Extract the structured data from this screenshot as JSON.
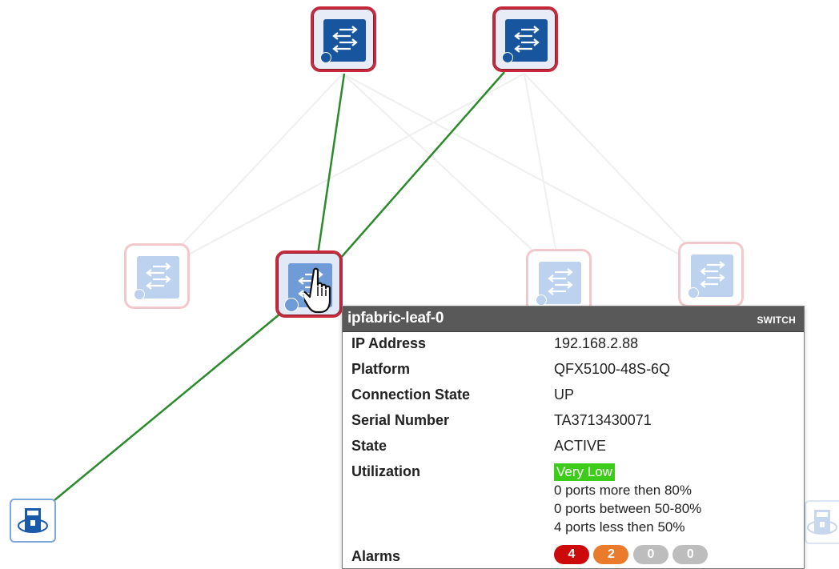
{
  "tooltip": {
    "title": "ipfabric-leaf-0",
    "type": "SWITCH",
    "rows": [
      {
        "label": "IP Address",
        "value": "192.168.2.88"
      },
      {
        "label": "Platform",
        "value": "QFX5100-48S-6Q"
      },
      {
        "label": "Connection State",
        "value": "UP"
      },
      {
        "label": "Serial Number",
        "value": "TA3713430071"
      },
      {
        "label": "State",
        "value": "ACTIVE"
      }
    ],
    "utilization": {
      "label": "Utilization",
      "level": "Very Low",
      "level_color": "#3ecc1a",
      "lines": [
        "0 ports more then 80%",
        "0 ports between 50-80%",
        "4 ports less then 50%"
      ]
    },
    "alarms": {
      "label": "Alarms",
      "items": [
        {
          "value": "4",
          "color": "#cc0a0a"
        },
        {
          "value": "2",
          "color": "#ea7b2c"
        },
        {
          "value": "0",
          "color": "#bdbdbd"
        },
        {
          "value": "0",
          "color": "#bdbdbd"
        }
      ]
    }
  },
  "icons": {
    "spine": "switch-icon",
    "leaf": "switch-icon",
    "host": "server-icon",
    "cursor": "hand-pointer-icon"
  },
  "colors": {
    "active_link": "#2b8a2b",
    "inactive_link": "#ececec",
    "node_border": "#c8283c",
    "switch_blue": "#17559f"
  }
}
